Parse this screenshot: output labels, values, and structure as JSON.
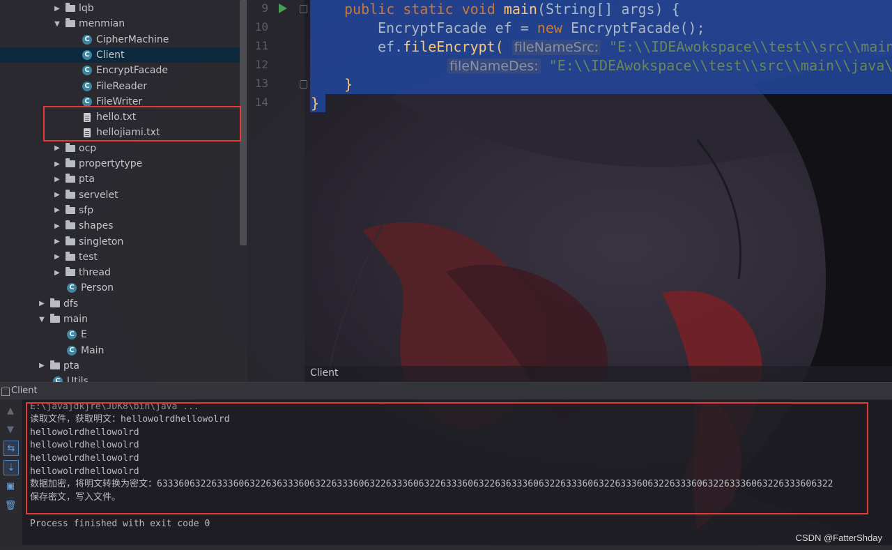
{
  "project_tree": {
    "items": [
      {
        "label": "lqb",
        "kind": "folder",
        "state": "collapsed"
      },
      {
        "label": "menmian",
        "kind": "folder",
        "state": "expanded"
      },
      {
        "label": "CipherMachine",
        "kind": "class"
      },
      {
        "label": "Client",
        "kind": "class",
        "selected": true
      },
      {
        "label": "EncryptFacade",
        "kind": "class"
      },
      {
        "label": "FileReader",
        "kind": "class"
      },
      {
        "label": "FileWriter",
        "kind": "class"
      },
      {
        "label": "hello.txt",
        "kind": "text-file"
      },
      {
        "label": "hellojiami.txt",
        "kind": "text-file"
      },
      {
        "label": "ocp",
        "kind": "folder",
        "state": "collapsed"
      },
      {
        "label": "propertytype",
        "kind": "folder",
        "state": "collapsed"
      },
      {
        "label": "pta",
        "kind": "folder",
        "state": "collapsed"
      },
      {
        "label": "servelet",
        "kind": "folder",
        "state": "collapsed"
      },
      {
        "label": "sfp",
        "kind": "folder",
        "state": "collapsed"
      },
      {
        "label": "shapes",
        "kind": "folder",
        "state": "collapsed"
      },
      {
        "label": "singleton",
        "kind": "folder",
        "state": "collapsed"
      },
      {
        "label": "test",
        "kind": "folder",
        "state": "collapsed"
      },
      {
        "label": "thread",
        "kind": "folder",
        "state": "collapsed"
      },
      {
        "label": "Person",
        "kind": "class"
      },
      {
        "label": "dfs",
        "kind": "folder",
        "state": "collapsed"
      },
      {
        "label": "main",
        "kind": "folder",
        "state": "expanded"
      },
      {
        "label": "E",
        "kind": "class-main"
      },
      {
        "label": "Main",
        "kind": "class-main"
      },
      {
        "label": "pta",
        "kind": "folder",
        "state": "collapsed"
      },
      {
        "label": "Utils",
        "kind": "class-main"
      }
    ],
    "class_icon_letter": "C",
    "arrow_collapsed": "▶",
    "arrow_expanded": "▼"
  },
  "editor": {
    "line_numbers": [
      "9",
      "10",
      "11",
      "12",
      "13",
      "14"
    ],
    "line9": {
      "kw1": "public static void ",
      "fn": "main",
      "rest": "(String[] args) {"
    },
    "line10": {
      "t1": "EncryptFacade ef = ",
      "kw": "new",
      "t2": " EncryptFacade();"
    },
    "line11": {
      "t1": "ef.",
      "fn": "fileEncrypt",
      "t2": "( ",
      "hint": "fileNameSrc:",
      "str": " \"E:\\\\IDEAwokspace\\\\test\\\\src\\\\main\\\\"
    },
    "line12": {
      "hint": "fileNameDes:",
      "str": " \"E:\\\\IDEAwokspace\\\\test\\\\src\\\\main\\\\java\\\\"
    },
    "line13": "}",
    "line14": "}",
    "footer_breadcrumb": "Client"
  },
  "run_panel": {
    "title": "Client",
    "toolbar_icons": [
      "up-arrow-icon",
      "down-arrow-icon",
      "soft-wrap-icon",
      "scroll-to-end-icon",
      "print-icon",
      "trash-icon"
    ],
    "console_lines": [
      "E:\\javajdkjre\\JDK8\\bin\\java ...",
      "读取文件，获取明文：hellowolrdhellowolrd",
      "hellowolrdhellowolrd",
      "hellowolrdhellowolrd",
      "hellowolrdhellowolrd",
      "hellowolrdhellowolrd",
      "数据加密，将明文转换为密文：6333606322633360632263633360632263336063226333606322633360632263633360632263336063226333606322633360632263336063226333606322",
      "保存密文，写入文件。",
      "",
      "Process finished with exit code 0"
    ]
  },
  "colors": {
    "highlight_box": "#e5393a",
    "selection": "#22469a",
    "keyword": "#cc7832",
    "function": "#ffc66d",
    "string": "#6a8759"
  },
  "watermark": "CSDN @FatterShday"
}
